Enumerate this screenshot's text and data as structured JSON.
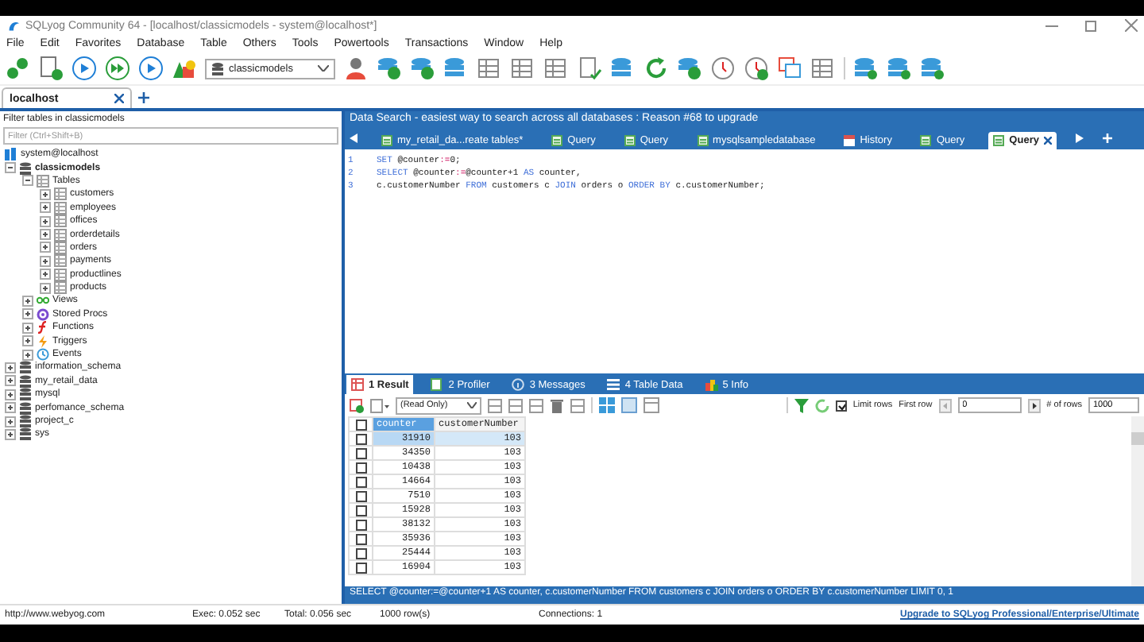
{
  "window": {
    "title": "SQLyog Community 64 - [localhost/classicmodels - system@localhost*]"
  },
  "menu": [
    "File",
    "Edit",
    "Favorites",
    "Database",
    "Table",
    "Others",
    "Tools",
    "Powertools",
    "Transactions",
    "Window",
    "Help"
  ],
  "toolbar": {
    "database": "classicmodels"
  },
  "connection_tabs": [
    {
      "label": "localhost",
      "selected": true
    }
  ],
  "object_browser": {
    "filter_label": "Filter tables in classicmodels",
    "filter_placeholder": "Filter (Ctrl+Shift+B)",
    "tree": [
      {
        "label": "system@localhost",
        "kind": "server",
        "children": [
          {
            "label": "classicmodels",
            "kind": "database",
            "expanded": true,
            "bold": true,
            "children": [
              {
                "label": "Tables",
                "kind": "folder",
                "expanded": true,
                "children": [
                  {
                    "label": "customers",
                    "kind": "table",
                    "expanded": false
                  },
                  {
                    "label": "employees",
                    "kind": "table",
                    "expanded": false
                  },
                  {
                    "label": "offices",
                    "kind": "table",
                    "expanded": false
                  },
                  {
                    "label": "orderdetails",
                    "kind": "table",
                    "expanded": false
                  },
                  {
                    "label": "orders",
                    "kind": "table",
                    "expanded": false
                  },
                  {
                    "label": "payments",
                    "kind": "table",
                    "expanded": false
                  },
                  {
                    "label": "productlines",
                    "kind": "table",
                    "expanded": false
                  },
                  {
                    "label": "products",
                    "kind": "table",
                    "expanded": false
                  }
                ]
              },
              {
                "label": "Views",
                "kind": "views",
                "expanded": false
              },
              {
                "label": "Stored Procs",
                "kind": "procs",
                "expanded": false
              },
              {
                "label": "Functions",
                "kind": "functions",
                "expanded": false
              },
              {
                "label": "Triggers",
                "kind": "triggers",
                "expanded": false
              },
              {
                "label": "Events",
                "kind": "events",
                "expanded": false
              }
            ]
          },
          {
            "label": "information_schema",
            "kind": "database",
            "expanded": false
          },
          {
            "label": "my_retail_data",
            "kind": "database",
            "expanded": false
          },
          {
            "label": "mysql",
            "kind": "database",
            "expanded": false
          },
          {
            "label": "perfomance_schema",
            "kind": "database",
            "expanded": false
          },
          {
            "label": "project_c",
            "kind": "database",
            "expanded": false
          },
          {
            "label": "sys",
            "kind": "database",
            "expanded": false
          }
        ]
      }
    ]
  },
  "banner": "Data Search - easiest way to search across all databases : Reason #68 to upgrade",
  "query_tabs": [
    {
      "label": "my_retail_da...reate tables*",
      "kind": "query",
      "selected": false
    },
    {
      "label": "Query",
      "kind": "query",
      "selected": false
    },
    {
      "label": "Query",
      "kind": "query",
      "selected": false
    },
    {
      "label": "mysqlsampledatabase",
      "kind": "query",
      "selected": false
    },
    {
      "label": "History",
      "kind": "history",
      "selected": false
    },
    {
      "label": "Query",
      "kind": "query",
      "selected": false
    },
    {
      "label": "Query",
      "kind": "query",
      "selected": true
    }
  ],
  "editor": {
    "lines": [
      {
        "number": "1",
        "tokens": [
          {
            "text": "SET ",
            "kind": "keyword"
          },
          {
            "text": "@counter",
            "kind": "plain"
          },
          {
            "text": ":=",
            "kind": "operator"
          },
          {
            "text": "0;",
            "kind": "plain"
          }
        ]
      },
      {
        "number": "2",
        "tokens": [
          {
            "text": "SELECT ",
            "kind": "keyword"
          },
          {
            "text": "@counter",
            "kind": "plain"
          },
          {
            "text": ":=",
            "kind": "operator"
          },
          {
            "text": "@counter+1 ",
            "kind": "plain"
          },
          {
            "text": "AS ",
            "kind": "keyword"
          },
          {
            "text": "counter,",
            "kind": "plain"
          }
        ]
      },
      {
        "number": "3",
        "tokens": [
          {
            "text": "c.customerNumber ",
            "kind": "plain"
          },
          {
            "text": "FROM ",
            "kind": "keyword"
          },
          {
            "text": "customers c ",
            "kind": "plain"
          },
          {
            "text": "JOIN ",
            "kind": "keyword"
          },
          {
            "text": "orders o ",
            "kind": "plain"
          },
          {
            "text": "ORDER BY ",
            "kind": "keyword"
          },
          {
            "text": "c.customerNumber;",
            "kind": "plain"
          }
        ]
      }
    ]
  },
  "result_tabs": [
    {
      "label": "1 Result",
      "kind": "result",
      "selected": true
    },
    {
      "label": "2 Profiler",
      "kind": "profiler",
      "selected": false
    },
    {
      "label": "3 Messages",
      "kind": "messages",
      "selected": false
    },
    {
      "label": "4 Table Data",
      "kind": "tabledata",
      "selected": false
    },
    {
      "label": "5 Info",
      "kind": "info",
      "selected": false
    }
  ],
  "result_toolbar": {
    "mode": "(Read Only)",
    "limit_rows": {
      "label": "Limit rows",
      "checked": true
    },
    "first_row": {
      "label": "First row",
      "value": "0"
    },
    "num_rows": {
      "label": "# of rows",
      "value": "1000"
    }
  },
  "grid": {
    "all_checked": false,
    "columns": [
      {
        "label": "counter",
        "selected": true
      },
      {
        "label": "customerNumber",
        "selected": false
      }
    ],
    "rows": [
      {
        "cells": [
          "31910",
          "103"
        ],
        "checked": false,
        "selected": true
      },
      {
        "cells": [
          "34350",
          "103"
        ],
        "checked": false,
        "selected": false
      },
      {
        "cells": [
          "10438",
          "103"
        ],
        "checked": false,
        "selected": false
      },
      {
        "cells": [
          "14664",
          "103"
        ],
        "checked": false,
        "selected": false
      },
      {
        "cells": [
          "7510",
          "103"
        ],
        "checked": false,
        "selected": false
      },
      {
        "cells": [
          "15928",
          "103"
        ],
        "checked": false,
        "selected": false
      },
      {
        "cells": [
          "38132",
          "103"
        ],
        "checked": false,
        "selected": false
      },
      {
        "cells": [
          "35936",
          "103"
        ],
        "checked": false,
        "selected": false
      },
      {
        "cells": [
          "25444",
          "103"
        ],
        "checked": false,
        "selected": false
      },
      {
        "cells": [
          "16904",
          "103"
        ],
        "checked": false,
        "selected": false
      }
    ]
  },
  "sql_status": "SELECT @counter:=@counter+1 AS counter, c.customerNumber FROM customers c JOIN orders o ORDER BY c.customerNumber LIMIT 0, 1",
  "status_bar": {
    "url": "http://www.webyog.com",
    "exec": "Exec: 0.052 sec",
    "total": "Total: 0.056 sec",
    "rows": "1000 row(s)",
    "connections": "Connections: 1",
    "upgrade_link": "Upgrade to SQLyog Professional/Enterprise/Ultimate"
  }
}
